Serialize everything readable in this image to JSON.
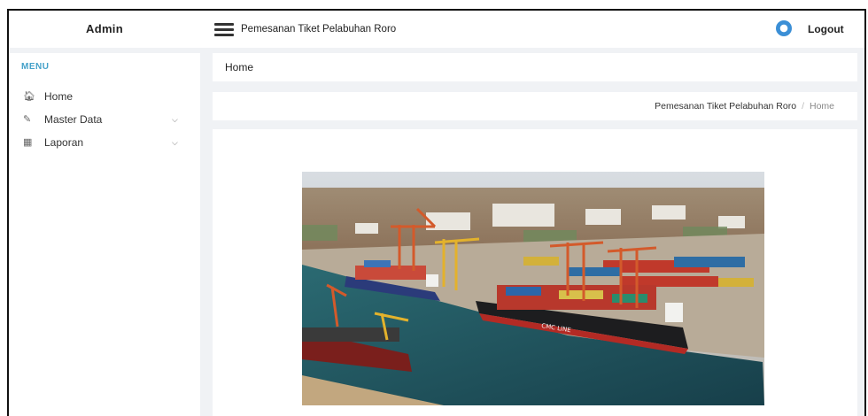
{
  "header": {
    "brand": "Admin",
    "title": "Pemesanan Tiket Pelabuhan Roro",
    "logout_label": "Logout",
    "menu_icon": "hamburger-menu-icon",
    "user_icon": "user-avatar-icon"
  },
  "sidebar": {
    "heading": "MENU",
    "items": [
      {
        "label": "Home",
        "icon": "home-icon"
      },
      {
        "label": "Master Data",
        "icon": "edit-icon",
        "chevron": "chevron-down-icon"
      },
      {
        "label": "Laporan",
        "icon": "calendar-icon",
        "chevron": "chevron-down-icon"
      }
    ]
  },
  "page": {
    "heading": "Home",
    "breadcrumb": [
      "Pemesanan Tiket Pelabuhan Roro",
      "Home"
    ],
    "breadcrumb_separator": "/"
  },
  "colors": {
    "accent": "#44a1c9",
    "background": "#f0f2f5",
    "user_icon": "#3b8fd6"
  },
  "image": {
    "subject": "harbor-container-port-photo",
    "ship_name": "CMC LINE"
  }
}
